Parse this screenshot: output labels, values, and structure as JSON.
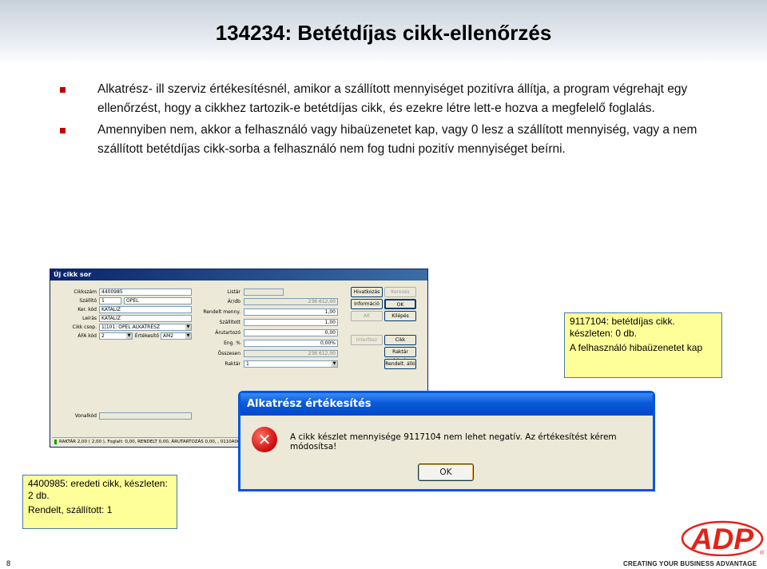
{
  "slide": {
    "title": "134234: Betétdíjas cikk-ellenőrzés",
    "bullets": [
      "Alkatrész- ill szerviz értékesítésnél, amikor a szállított mennyiséget pozitívra állítja, a program végrehajt egy ellenőrzést, hogy a cikkhez tartozik-e betétdíjas cikk, és ezekre létre lett-e hozva a megfelelő foglalás.",
      "Amennyiben nem, akkor a felhasználó vagy hibaüzenetet kap, vagy 0 lesz a szállított mennyiség, vagy a nem szállított betétdíjas cikk-sorba a felhasználó nem fog tudni pozitív mennyiséget beírni."
    ],
    "page_number": "8",
    "tagline": "CREATING YOUR BUSINESS ADVANTAGE",
    "brand_color": "#e2231a"
  },
  "dialog": {
    "title": "Új cikk sor",
    "labels": {
      "cikkszam": "Cikkszám",
      "szallito": "Szállító",
      "ker_kod": "Ker. kód",
      "leiras": "Leírás",
      "cikk_csop": "Cikk csop.",
      "afa_kod": "ÁFA kód",
      "ertekesito": "Értékesítő",
      "listar": "Listár",
      "ar": "Ár/db",
      "rendelt": "Rendelt menny.",
      "szallitott": "Szállított",
      "arutartozo": "Árutartozó",
      "eng": "Eng. %",
      "osszesen": "Összesen",
      "raktar": "Raktár",
      "vonalkod": "Vonalkód"
    },
    "values": {
      "cikkszam": "4400985",
      "szallito_code": "1",
      "szallito_name": "OPEL",
      "ker_kod": "KATALIZ",
      "leiras": "KATALIZ",
      "cikk_csop": "1|101: OPEL ALKATRÉSZ",
      "afa_kod": "2",
      "ertekesito": "AM2",
      "listar": "",
      "ar": "236 612,00",
      "rendelt": "1,00",
      "szallitott": "1,00",
      "arutartozo": "0,00",
      "eng": "0,00%",
      "osszesen": "236 612,00",
      "raktar": "1",
      "vonalkod": ""
    },
    "buttons": {
      "hivatkozas": "Hivatkozás",
      "kereses": "Keresés",
      "informacio": "Információ",
      "ok": "OK",
      "ak": "AK",
      "kilepes": "Kilépés",
      "interfesz": "Interfész",
      "cikk": "Cikk",
      "raktar_keszl": "Raktár készl.",
      "rendelt_allo": "Rendelt. álló"
    },
    "status": "RAKTÁR 2,00 ( 2,00 ), Foglalt: 0,00, RENDELT 0,00, ÁRUTARTOZÁS 0,00,  , 0110A00.."
  },
  "error_dialog": {
    "title": "Alkatrész értékesítés",
    "icon": "error-x-icon",
    "message": "A cikk készlet mennyisége 9117104 nem lehet negatív. Az értékesítést kérem módosítsa!",
    "ok_label": "OK"
  },
  "notes": {
    "right": [
      "9117104: betétdíjas cikk. készleten: 0 db.",
      "A felhasználó hibaüzenetet kap"
    ],
    "left": [
      "4400985: eredeti cikk, készleten: 2 db.",
      "Rendelt, szállított: 1"
    ]
  },
  "logo": {
    "name": "adp-logo",
    "text": "ADP"
  }
}
